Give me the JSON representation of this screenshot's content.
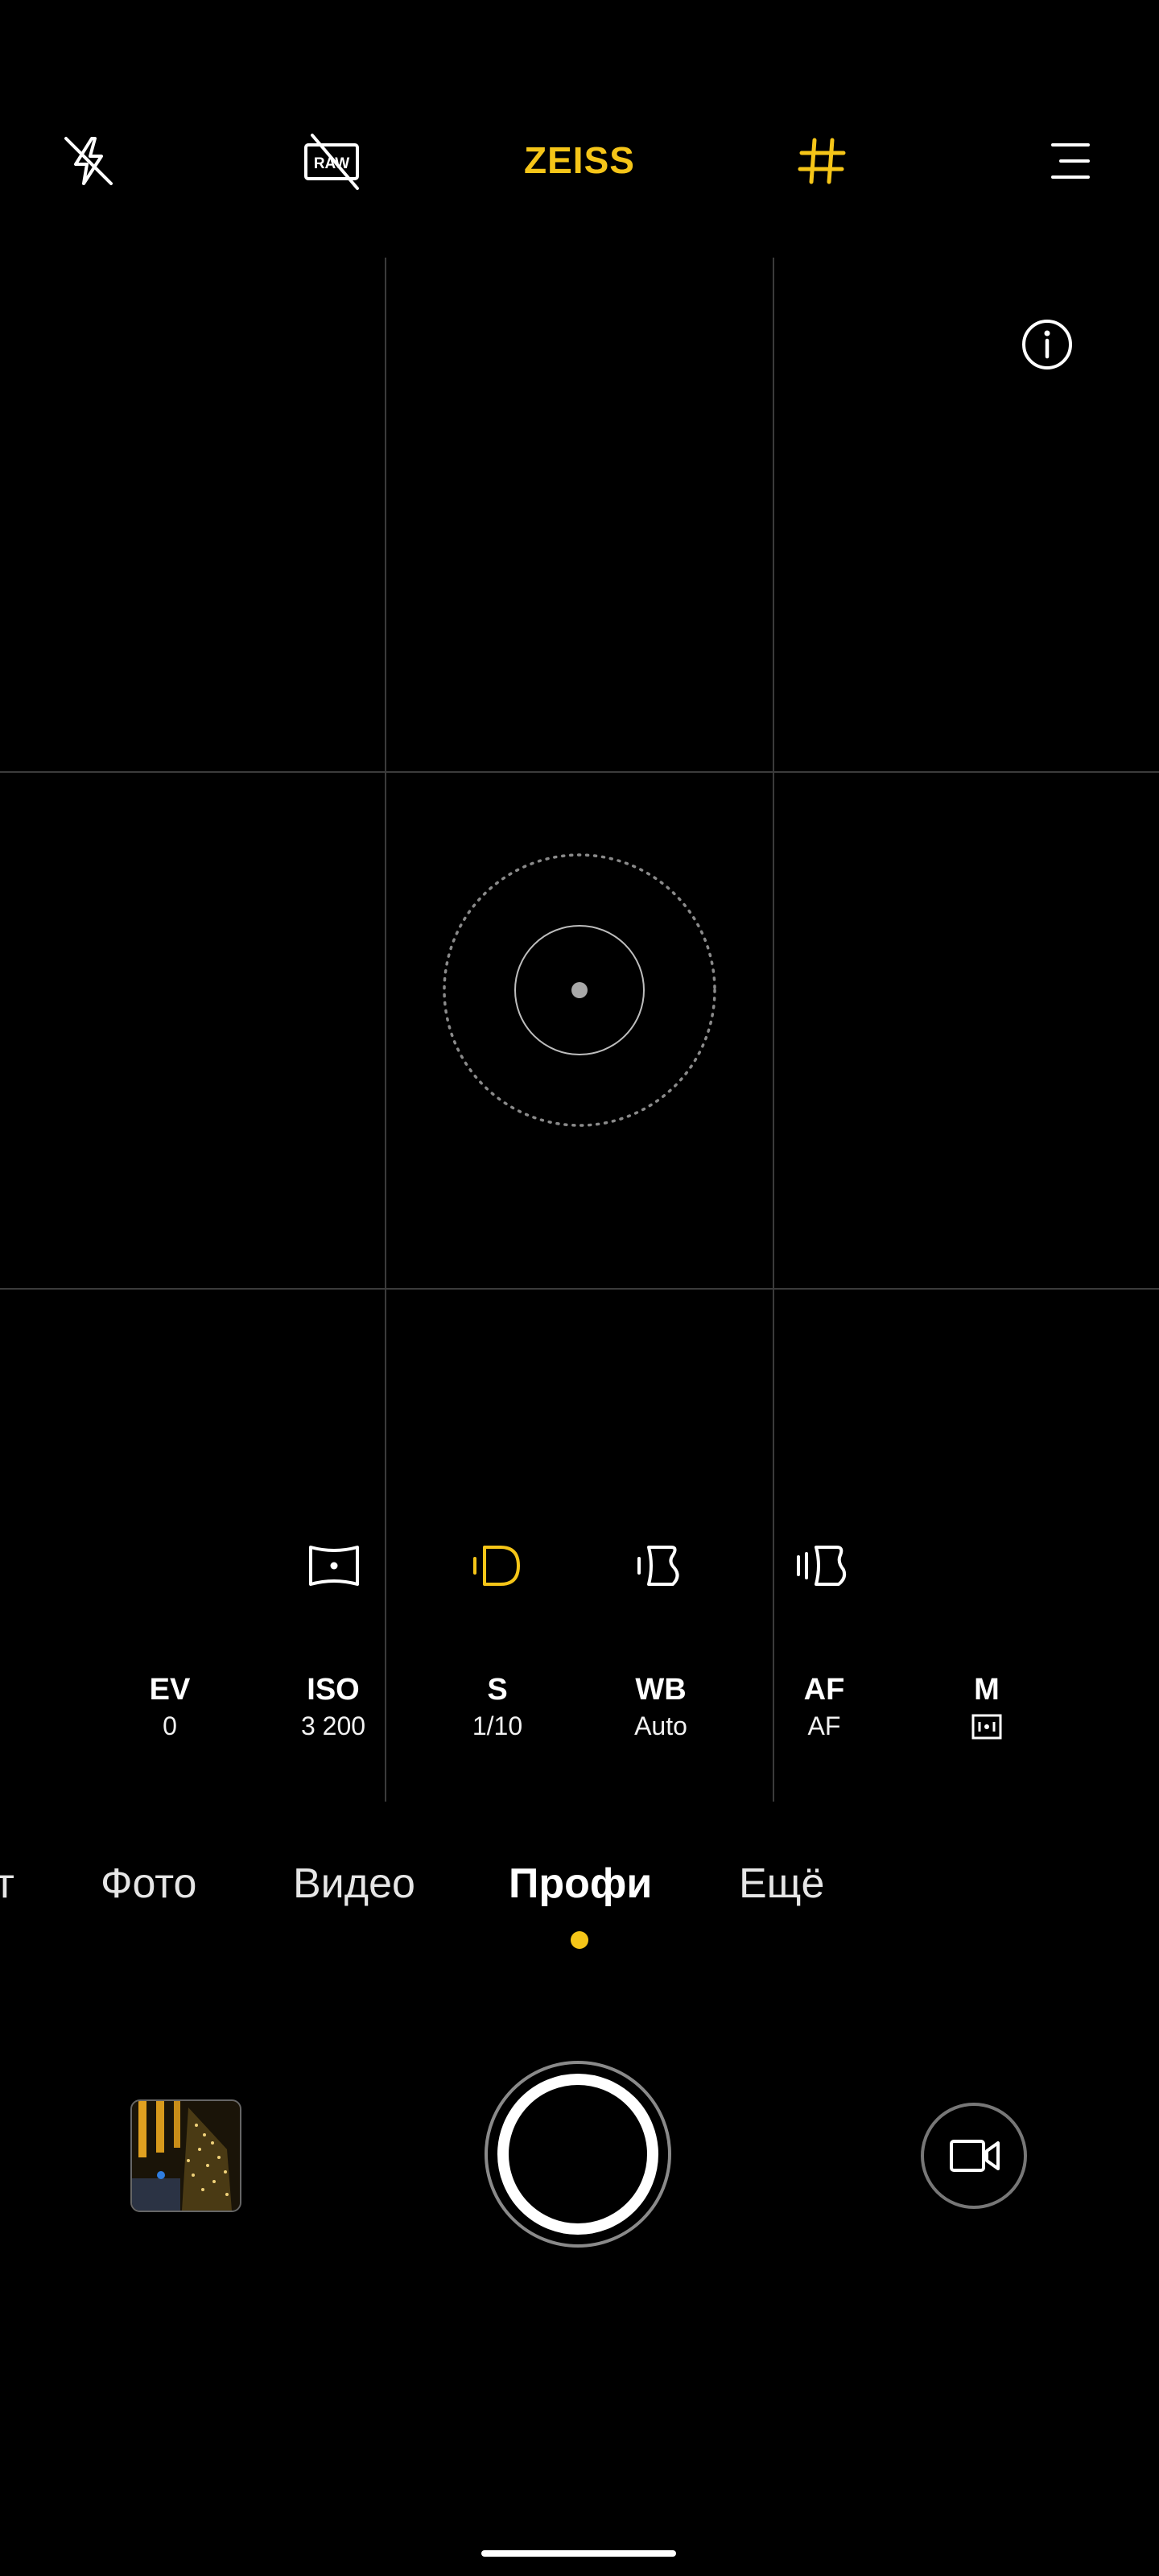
{
  "top_bar": {
    "flash_icon": "flash-off-icon",
    "raw_icon": "raw-off-icon",
    "raw_label": "RAW",
    "brand": "ZEISS",
    "grid_icon": "grid-icon",
    "menu_icon": "menu-icon"
  },
  "viewfinder": {
    "info_icon": "info-icon"
  },
  "pro_modes": [
    {
      "icon": "panorama-frame-icon",
      "active": false
    },
    {
      "icon": "light-trail-icon",
      "active": true
    },
    {
      "icon": "silky-water-icon",
      "active": false
    },
    {
      "icon": "star-trail-icon",
      "active": false
    }
  ],
  "params": [
    {
      "key": "EV",
      "value": "0"
    },
    {
      "key": "ISO",
      "value": "3 200"
    },
    {
      "key": "S",
      "value": "1/10"
    },
    {
      "key": "WB",
      "value": "Auto"
    },
    {
      "key": "AF",
      "value": "AF"
    },
    {
      "key": "M",
      "value": ""
    }
  ],
  "metering_icon": "metering-icon",
  "modes": [
    {
      "label": "т"
    },
    {
      "label": "Фото"
    },
    {
      "label": "Видео"
    },
    {
      "label": "Профи",
      "active": true
    },
    {
      "label": "Ещё"
    }
  ],
  "colors": {
    "accent": "#F5C518",
    "background": "#000000"
  },
  "bottom": {
    "gallery_thumb": "gallery-thumbnail",
    "shutter": "shutter-button",
    "video_icon": "video-camera-icon"
  }
}
